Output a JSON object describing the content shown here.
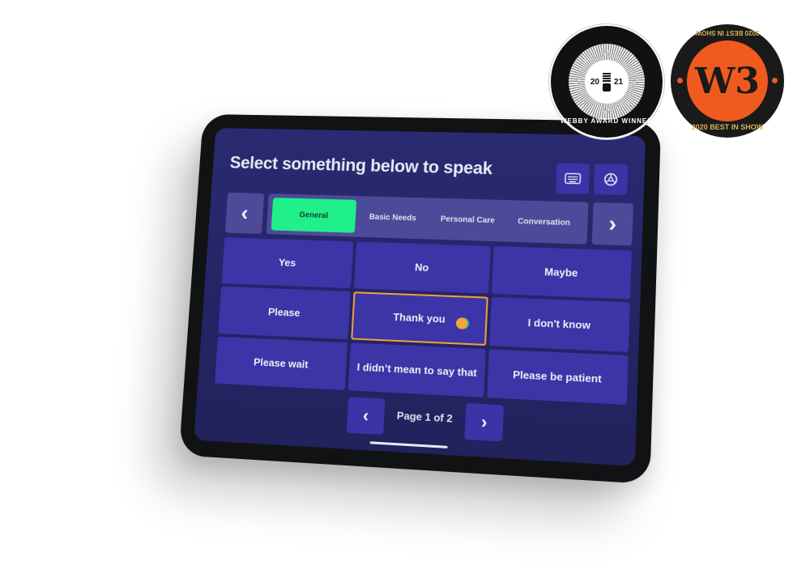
{
  "app": {
    "title": "Select something below to speak",
    "toolbar": {
      "keyboard_icon": "keyboard-icon",
      "settings_icon": "gear-icon"
    },
    "category_nav": {
      "prev_icon": "chevron-left-icon",
      "next_icon": "chevron-right-icon",
      "prev_glyph": "‹",
      "next_glyph": "›",
      "tabs": [
        {
          "label": "General",
          "active": true
        },
        {
          "label": "Basic Needs",
          "active": false
        },
        {
          "label": "Personal Care",
          "active": false
        },
        {
          "label": "Conversation",
          "active": false
        }
      ]
    },
    "phrases": [
      {
        "label": "Yes"
      },
      {
        "label": "No"
      },
      {
        "label": "Maybe"
      },
      {
        "label": "Please"
      },
      {
        "label": "Thank you",
        "selected": true
      },
      {
        "label": "I don't know"
      },
      {
        "label": "Please wait"
      },
      {
        "label": "I didn’t mean to say that"
      },
      {
        "label": "Please be patient"
      }
    ],
    "pager": {
      "label": "Page 1 of 2",
      "current_page": 1,
      "total_pages": 2,
      "prev_glyph": "‹",
      "next_glyph": "›"
    },
    "colors": {
      "screen_bg": "#2a2a72",
      "tile": "#3b35a8",
      "tab_bar": "#4e4a9a",
      "active_tab": "#1ff08a",
      "selection_outline": "#f0a23a"
    }
  },
  "badges": {
    "webby": {
      "year_left": "20",
      "year_right": "21",
      "text": "WEBBY AWARD WINNER"
    },
    "w3": {
      "logo": "W3",
      "text_bottom": "2020 BEST IN SHOW",
      "text_top": "2020 BEST IN SHOW"
    }
  }
}
